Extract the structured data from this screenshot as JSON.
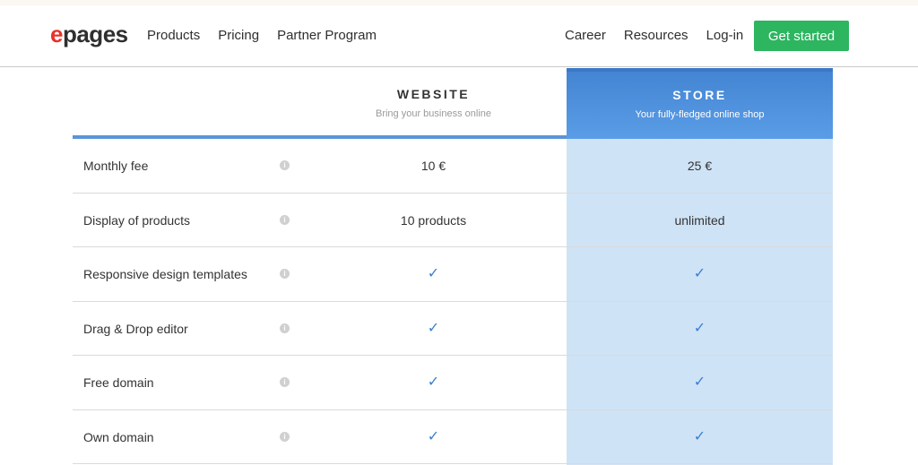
{
  "logo": {
    "e": "e",
    "rest": "pages"
  },
  "nav": {
    "left": [
      "Products",
      "Pricing",
      "Partner Program"
    ],
    "right": [
      "Career",
      "Resources",
      "Log-in"
    ],
    "cta": "Get started"
  },
  "plans": {
    "website": {
      "title": "WEBSITE",
      "subtitle": "Bring your business online"
    },
    "store": {
      "title": "STORE",
      "subtitle": "Your fully-fledged online shop"
    }
  },
  "info_glyph": "i",
  "check_glyph": "✓",
  "rows": [
    {
      "label": "Monthly fee",
      "website": "10 €",
      "store": "25 €"
    },
    {
      "label": "Display of products",
      "website": "10 products",
      "store": "unlimited"
    },
    {
      "label": "Responsive design templates",
      "website": "✓",
      "store": "✓"
    },
    {
      "label": "Drag & Drop editor",
      "website": "✓",
      "store": "✓"
    },
    {
      "label": "Free domain",
      "website": "✓",
      "store": "✓"
    },
    {
      "label": "Own domain",
      "website": "✓",
      "store": "✓"
    }
  ],
  "colors": {
    "brand_red": "#e8322a",
    "cta_green": "#2db560",
    "store_blue": "#4a8cdc",
    "store_bg": "#cfe3f6",
    "check_blue": "#3a7fd0"
  }
}
